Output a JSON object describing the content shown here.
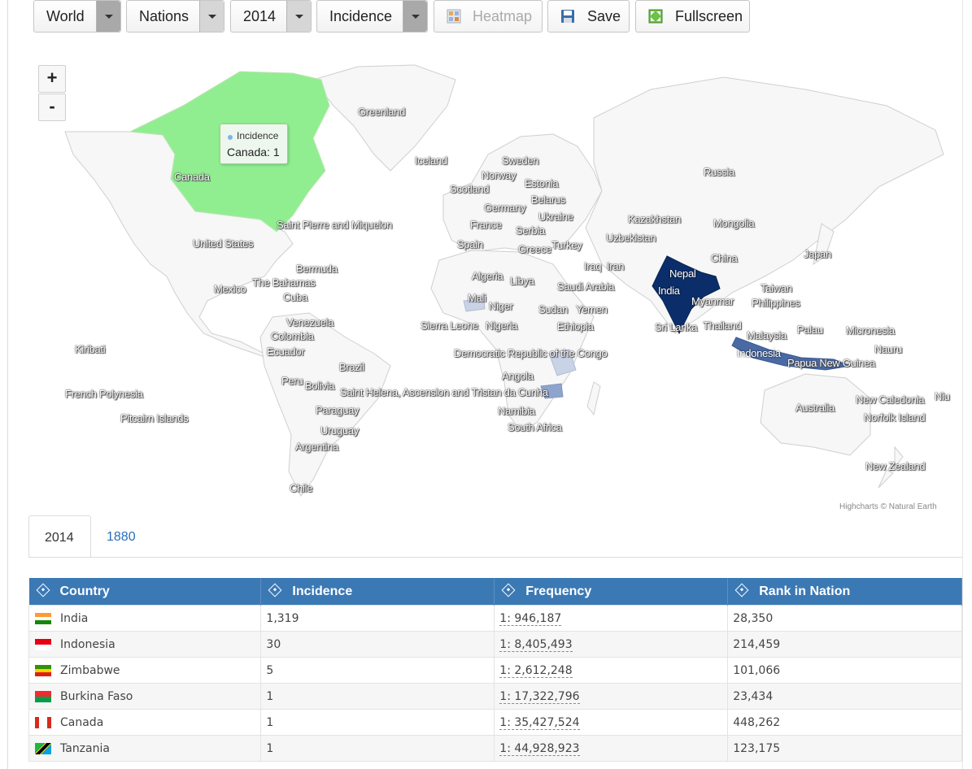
{
  "toolbar": {
    "region": "World",
    "level": "Nations",
    "year": "2014",
    "measure": "Incidence",
    "heatmap_label": "Heatmap",
    "save_label": "Save",
    "fullscreen_label": "Fullscreen"
  },
  "map": {
    "zoom_in": "+",
    "zoom_out": "-",
    "credit": "Highcharts © Natural Earth",
    "tooltip": {
      "series": "Incidence",
      "value": "Canada: 1"
    },
    "labels": [
      {
        "text": "Greenland"
      },
      {
        "text": "Iceland"
      },
      {
        "text": "Sweden"
      },
      {
        "text": "Norway"
      },
      {
        "text": "Estonia"
      },
      {
        "text": "Scotland"
      },
      {
        "text": "Belarus"
      },
      {
        "text": "Germany"
      },
      {
        "text": "Ukraine"
      },
      {
        "text": "France"
      },
      {
        "text": "Serbia"
      },
      {
        "text": "Spain"
      },
      {
        "text": "Greece"
      },
      {
        "text": "Turkey"
      },
      {
        "text": "Russia"
      },
      {
        "text": "Kazakhstan"
      },
      {
        "text": "Mongolia"
      },
      {
        "text": "Uzbekistan"
      },
      {
        "text": "Japan"
      },
      {
        "text": "China"
      },
      {
        "text": "Iraq"
      },
      {
        "text": "Iran"
      },
      {
        "text": "Nepal"
      },
      {
        "text": "India"
      },
      {
        "text": "Taiwan"
      },
      {
        "text": "Philippines"
      },
      {
        "text": "Myanmar"
      },
      {
        "text": "Canada"
      },
      {
        "text": "Saint Pierre and Miquelon"
      },
      {
        "text": "United States"
      },
      {
        "text": "Bermuda"
      },
      {
        "text": "Mexico"
      },
      {
        "text": "The Bahamas"
      },
      {
        "text": "Cuba"
      },
      {
        "text": "Venezuela"
      },
      {
        "text": "Colombia"
      },
      {
        "text": "Ecuador"
      },
      {
        "text": "Brazil"
      },
      {
        "text": "Peru"
      },
      {
        "text": "Bolivia"
      },
      {
        "text": "Paraguay"
      },
      {
        "text": "Uruguay"
      },
      {
        "text": "Argentina"
      },
      {
        "text": "Chile"
      },
      {
        "text": "Kiribati"
      },
      {
        "text": "French Polynesia"
      },
      {
        "text": "Pitcairn Islands"
      },
      {
        "text": "Algeria"
      },
      {
        "text": "Libya"
      },
      {
        "text": "Mali"
      },
      {
        "text": "Niger"
      },
      {
        "text": "Saudi Arabia"
      },
      {
        "text": "Sudan"
      },
      {
        "text": "Yemen"
      },
      {
        "text": "Sierra Leone"
      },
      {
        "text": "Nigeria"
      },
      {
        "text": "Ethiopia"
      },
      {
        "text": "Democratic Republic of the Congo"
      },
      {
        "text": "Angola"
      },
      {
        "text": "Saint Helena, Ascension and Tristan da Cunha"
      },
      {
        "text": "Namibia"
      },
      {
        "text": "South Africa"
      },
      {
        "text": "Sri Lanka"
      },
      {
        "text": "Thailand"
      },
      {
        "text": "Malaysia"
      },
      {
        "text": "Palau"
      },
      {
        "text": "Micronesia"
      },
      {
        "text": "Nauru"
      },
      {
        "text": "Indonesia"
      },
      {
        "text": "Papua New Guinea"
      },
      {
        "text": "Australia"
      },
      {
        "text": "New Caledonia"
      },
      {
        "text": "Niu"
      },
      {
        "text": "Norfolk Island"
      },
      {
        "text": "New Zealand"
      }
    ]
  },
  "tabs": [
    {
      "label": "2014",
      "active": true
    },
    {
      "label": "1880",
      "active": false
    }
  ],
  "table": {
    "headers": [
      "Country",
      "Incidence",
      "Frequency",
      "Rank in Nation"
    ],
    "rows": [
      {
        "country": "India",
        "incidence": "1,319",
        "frequency": "1: 946,187",
        "rank": "28,350",
        "flag": "india"
      },
      {
        "country": "Indonesia",
        "incidence": "30",
        "frequency": "1: 8,405,493",
        "rank": "214,459",
        "flag": "indonesia"
      },
      {
        "country": "Zimbabwe",
        "incidence": "5",
        "frequency": "1: 2,612,248",
        "rank": "101,066",
        "flag": "zimbabwe"
      },
      {
        "country": "Burkina Faso",
        "incidence": "1",
        "frequency": "1: 17,322,796",
        "rank": "23,434",
        "flag": "burkina-faso"
      },
      {
        "country": "Canada",
        "incidence": "1",
        "frequency": "1: 35,427,524",
        "rank": "448,262",
        "flag": "canada"
      },
      {
        "country": "Tanzania",
        "incidence": "1",
        "frequency": "1: 44,928,923",
        "rank": "123,175",
        "flag": "tanzania"
      }
    ]
  },
  "colors": {
    "header_blue": "#3b79b5",
    "land": "#f7f7f7",
    "canada_green": "#90ee90",
    "india_navy": "#0b2e6b",
    "indonesia_blue": "#4a6aa5",
    "low_blue": "#c9d3e6"
  }
}
